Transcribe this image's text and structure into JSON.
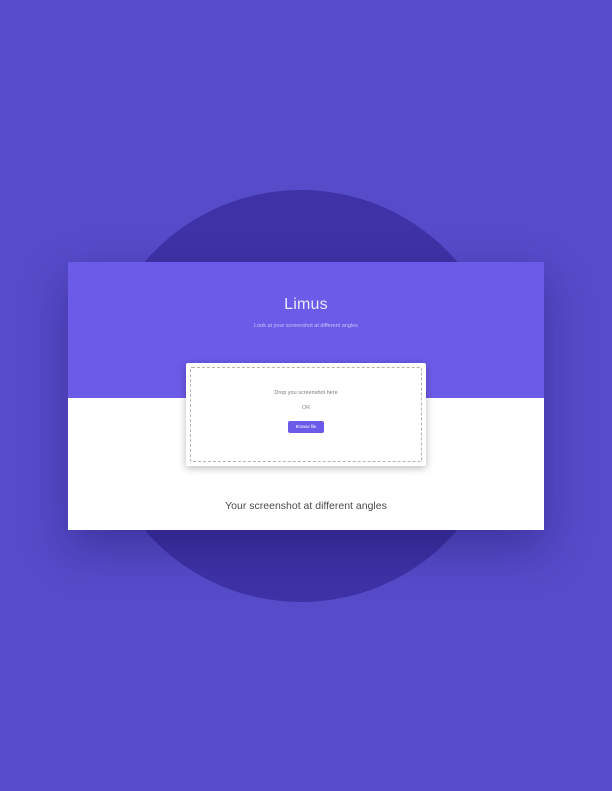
{
  "app": {
    "title": "Limus",
    "subtitle": "Look at your screenshot at different angles"
  },
  "upload": {
    "drop_prompt": "Drop you screenshot here",
    "or_label": "OR",
    "browse_label": "Browse file"
  },
  "results": {
    "heading": "Your screenshot at different angles"
  },
  "colors": {
    "page_background": "#564bc9",
    "circle": "#3e32a6",
    "accent": "#6c5be9",
    "card": "#ffffff"
  }
}
